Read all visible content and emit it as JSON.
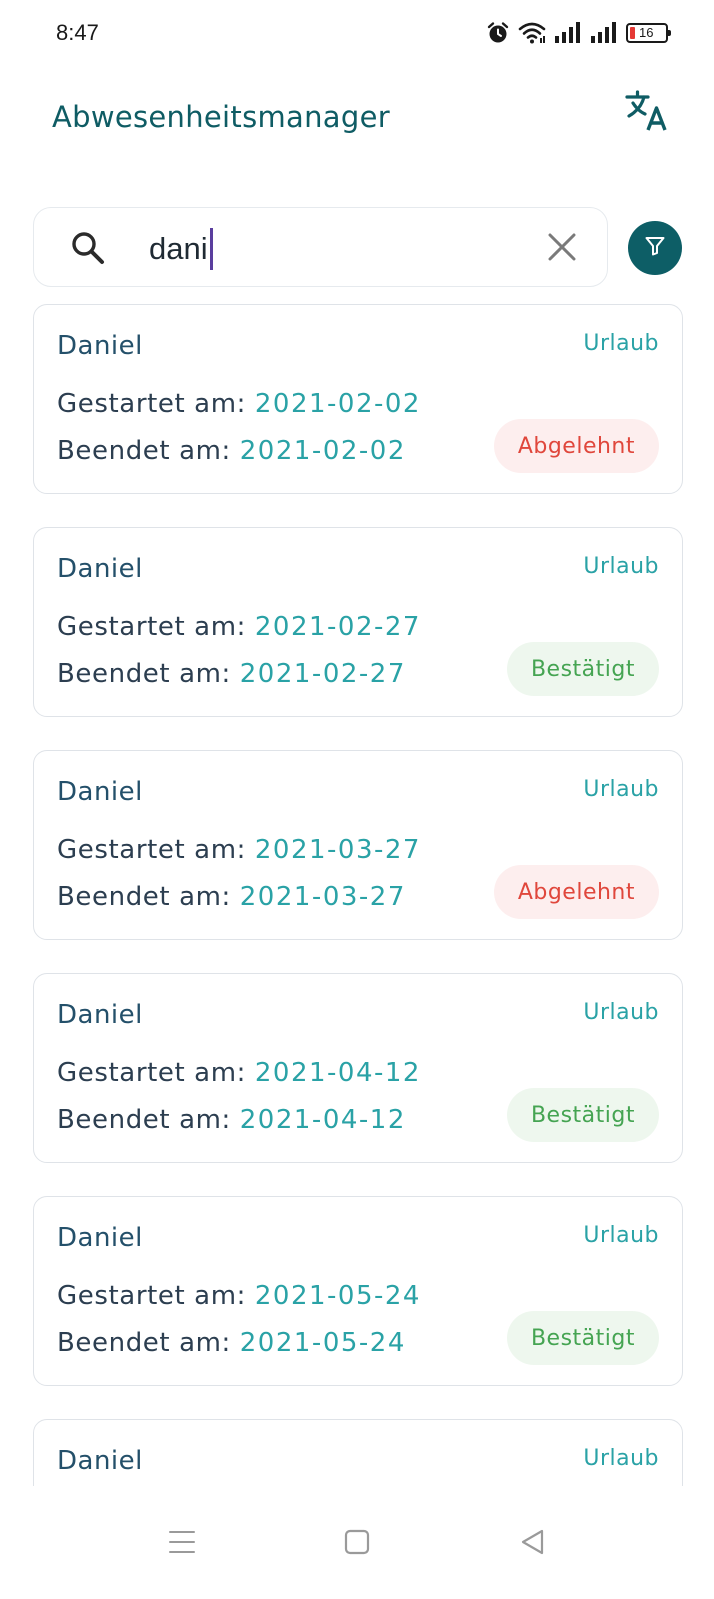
{
  "status_bar": {
    "time": "8:47",
    "battery_level": "16",
    "icons": [
      "alarm-icon",
      "wifi-icon",
      "signal-icon",
      "signal-icon",
      "battery-icon"
    ]
  },
  "header": {
    "title": "Abwesenheitsmanager",
    "translate_icon": "translate-icon"
  },
  "search": {
    "value": "dani",
    "icon": "search-icon",
    "clear_icon": "close-icon",
    "filter_icon": "filter-icon"
  },
  "absences": [
    {
      "name": "Daniel",
      "type": "Urlaub",
      "start_label": "Gestartet am:",
      "start_date": "2021-02-02",
      "end_label": "Beendet am:",
      "end_date": "2021-02-02",
      "status": "Abgelehnt",
      "status_kind": "rejected"
    },
    {
      "name": "Daniel",
      "type": "Urlaub",
      "start_label": "Gestartet am:",
      "start_date": "2021-02-27",
      "end_label": "Beendet am:",
      "end_date": "2021-02-27",
      "status": "Bestätigt",
      "status_kind": "confirmed"
    },
    {
      "name": "Daniel",
      "type": "Urlaub",
      "start_label": "Gestartet am:",
      "start_date": "2021-03-27",
      "end_label": "Beendet am:",
      "end_date": "2021-03-27",
      "status": "Abgelehnt",
      "status_kind": "rejected"
    },
    {
      "name": "Daniel",
      "type": "Urlaub",
      "start_label": "Gestartet am:",
      "start_date": "2021-04-12",
      "end_label": "Beendet am:",
      "end_date": "2021-04-12",
      "status": "Bestätigt",
      "status_kind": "confirmed"
    },
    {
      "name": "Daniel",
      "type": "Urlaub",
      "start_label": "Gestartet am:",
      "start_date": "2021-05-24",
      "end_label": "Beendet am:",
      "end_date": "2021-05-24",
      "status": "Bestätigt",
      "status_kind": "confirmed"
    },
    {
      "name": "Daniel",
      "type": "Urlaub"
    }
  ],
  "colors": {
    "primary": "#0d5e66",
    "accent": "#2aa2a6",
    "rejected_text": "#e0473c",
    "rejected_bg": "#fdeeee",
    "confirmed_text": "#45a452",
    "confirmed_bg": "#eef7ee"
  },
  "nav_bar": {
    "icons": [
      "menu-icon",
      "home-square-icon",
      "back-triangle-icon"
    ]
  }
}
